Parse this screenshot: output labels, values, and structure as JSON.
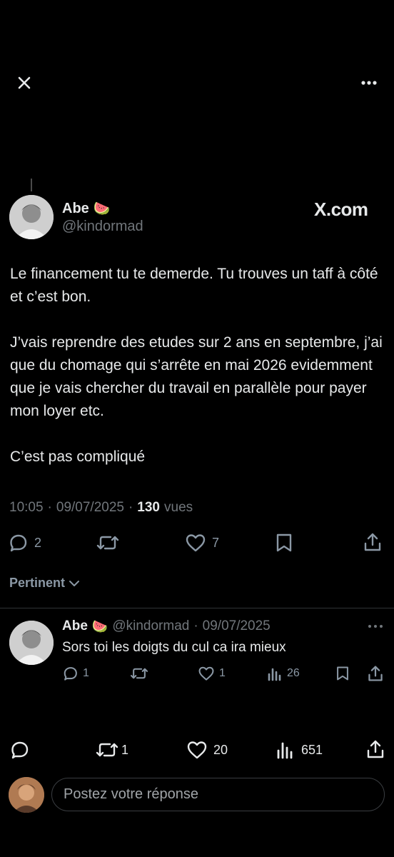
{
  "icons": {
    "close": "close-icon",
    "more": "more-horizontal-icon",
    "reply": "reply-icon",
    "retweet": "retweet-icon",
    "like": "heart-icon",
    "bookmark": "bookmark-icon",
    "share": "share-icon",
    "views": "views-icon",
    "watermelon": "🍉"
  },
  "colors": {
    "background": "#000000",
    "text": "#e7e9ea",
    "muted": "#71767b"
  },
  "tweet": {
    "author_name": "Abe",
    "author_emoji": "🍉",
    "handle": "@kindormad",
    "source": "X.com",
    "body": "Le financement tu te demerde. Tu trouves un taff à côté et c’est bon.\n\nJ’vais reprendre des etudes sur 2 ans en septembre, j’ai que du chomage qui s’arrête en mai 2026 evidemment que je vais chercher du travail en parallèle pour payer mon loyer etc.\n\nC’est pas compliqué",
    "time": "10:05",
    "date": "09/07/2025",
    "views_count": "130",
    "views_label": "vues",
    "reply_count": "2",
    "like_count": "7"
  },
  "sort_label": "Pertinent",
  "reply": {
    "author_name": "Abe",
    "author_emoji": "🍉",
    "handle": "@kindormad",
    "date": "09/07/2025",
    "text": "Sors toi les doigts du cul ca ira mieux",
    "reply_count": "1",
    "like_count": "1",
    "views_count": "26"
  },
  "bottom_bar": {
    "retweet_count": "1",
    "like_count": "20",
    "views_count": "651"
  },
  "composer": {
    "placeholder": "Postez votre réponse"
  }
}
